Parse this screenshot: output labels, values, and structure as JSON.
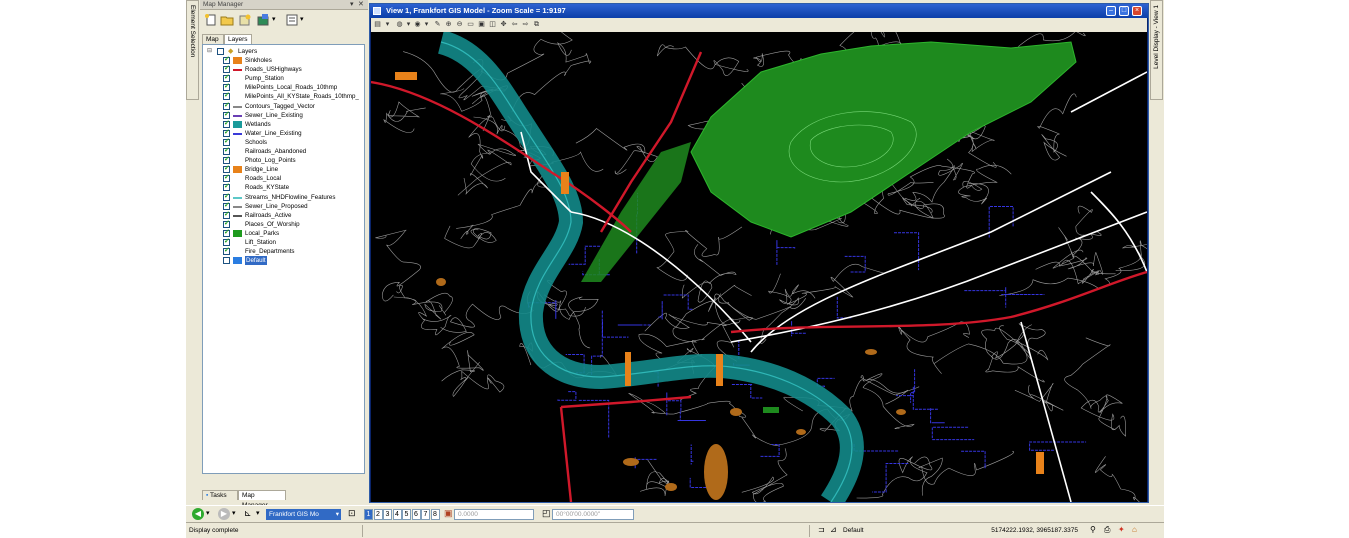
{
  "left_sidebar_tab": "Element Selection",
  "right_sidebar_tab": "Level Display - View 1",
  "map_manager": {
    "title": "Map Manager",
    "tabs": [
      "Map",
      "Layers"
    ],
    "active_tab": "Layers",
    "root_label": "Layers",
    "layers": [
      {
        "name": "Sinkholes",
        "checked": true,
        "swatch": "#e8821a",
        "swatch_type": "fill"
      },
      {
        "name": "Roads_USHighways",
        "checked": true,
        "swatch": "#d0182a",
        "swatch_type": "line"
      },
      {
        "name": "Pump_Station",
        "checked": true,
        "swatch": "",
        "swatch_type": "none"
      },
      {
        "name": "MilePoints_Local_Roads_10thmp",
        "checked": true,
        "swatch": "",
        "swatch_type": "none"
      },
      {
        "name": "MilePoints_All_KYState_Roads_10thmp_",
        "checked": true,
        "swatch": "",
        "swatch_type": "none"
      },
      {
        "name": "Contours_Tagged_Vector",
        "checked": true,
        "swatch": "#888888",
        "swatch_type": "line"
      },
      {
        "name": "Sewer_Line_Existing",
        "checked": true,
        "swatch": "#6a3fb4",
        "swatch_type": "line"
      },
      {
        "name": "Wetlands",
        "checked": true,
        "swatch": "#1a9a9a",
        "swatch_type": "fill"
      },
      {
        "name": "Water_Line_Existing",
        "checked": true,
        "swatch": "#3a3ad8",
        "swatch_type": "line"
      },
      {
        "name": "Schools",
        "checked": true,
        "swatch": "",
        "swatch_type": "none"
      },
      {
        "name": "Railroads_Abandoned",
        "checked": true,
        "swatch": "",
        "swatch_type": "none"
      },
      {
        "name": "Photo_Log_Points",
        "checked": true,
        "swatch": "",
        "swatch_type": "none"
      },
      {
        "name": "Bridge_Line",
        "checked": true,
        "swatch": "#e8821a",
        "swatch_type": "fill"
      },
      {
        "name": "Roads_Local",
        "checked": true,
        "swatch": "",
        "swatch_type": "none"
      },
      {
        "name": "Roads_KYState",
        "checked": true,
        "swatch": "",
        "swatch_type": "none"
      },
      {
        "name": "Streams_NHDFlowline_Features",
        "checked": true,
        "swatch": "#5cc8c8",
        "swatch_type": "line"
      },
      {
        "name": "Sewer_Line_Proposed",
        "checked": true,
        "swatch": "#888888",
        "swatch_type": "line"
      },
      {
        "name": "Railroads_Active",
        "checked": true,
        "swatch": "#555555",
        "swatch_type": "line"
      },
      {
        "name": "Places_Of_Worship",
        "checked": true,
        "swatch": "",
        "swatch_type": "none"
      },
      {
        "name": "Local_Parks",
        "checked": true,
        "swatch": "#1e9a1e",
        "swatch_type": "fill"
      },
      {
        "name": "Lift_Station",
        "checked": true,
        "swatch": "",
        "swatch_type": "none"
      },
      {
        "name": "Fire_Departments",
        "checked": true,
        "swatch": "",
        "swatch_type": "none"
      },
      {
        "name": "Default",
        "checked": false,
        "swatch": "#2a7de1",
        "swatch_type": "fill",
        "selected": true
      }
    ],
    "bottom_tabs": [
      "Tasks",
      "Map Manager"
    ]
  },
  "view": {
    "title": "View 1, Frankfort GIS Model - Zoom Scale = 1:9197"
  },
  "toolbar": {
    "model_select": "Frankfort GIS Mo",
    "view_numbers": [
      "1",
      "2",
      "3",
      "4",
      "5",
      "6",
      "7",
      "8"
    ],
    "active_view": "1",
    "distance_value": "0.0000",
    "angle_value": "00°00'00.0000\""
  },
  "status": {
    "message": "Display complete",
    "level": "Default",
    "coordinates": "5174222.1932, 3965187.3375"
  },
  "colors": {
    "park": "#1e8a1e",
    "river": "#1a9a9a",
    "highway": "#d0182a",
    "contours": "#cfcfcf",
    "water_lines": "#3535e0",
    "bridges": "#e8821a",
    "title_bar": "#0b3ea8"
  }
}
